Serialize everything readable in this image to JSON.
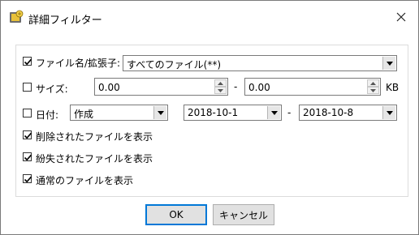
{
  "window": {
    "title": "詳細フィルター"
  },
  "filename": {
    "label": "ファイル名/拡張子:",
    "checked": true,
    "value": "すべてのファイル(**)"
  },
  "size": {
    "label": "サイズ:",
    "checked": false,
    "min": "0.00",
    "max": "0.00",
    "separator": "-",
    "unit": "KB"
  },
  "date": {
    "label": "日付:",
    "checked": false,
    "type": "作成",
    "from": "2018-10-1",
    "to": "2018-10-8",
    "separator": "-"
  },
  "options": [
    {
      "label": "削除されたファイルを表示",
      "checked": true
    },
    {
      "label": "紛失されたファイルを表示",
      "checked": true
    },
    {
      "label": "通常のファイルを表示",
      "checked": true
    }
  ],
  "buttons": {
    "ok": "OK",
    "cancel": "キャンセル"
  }
}
